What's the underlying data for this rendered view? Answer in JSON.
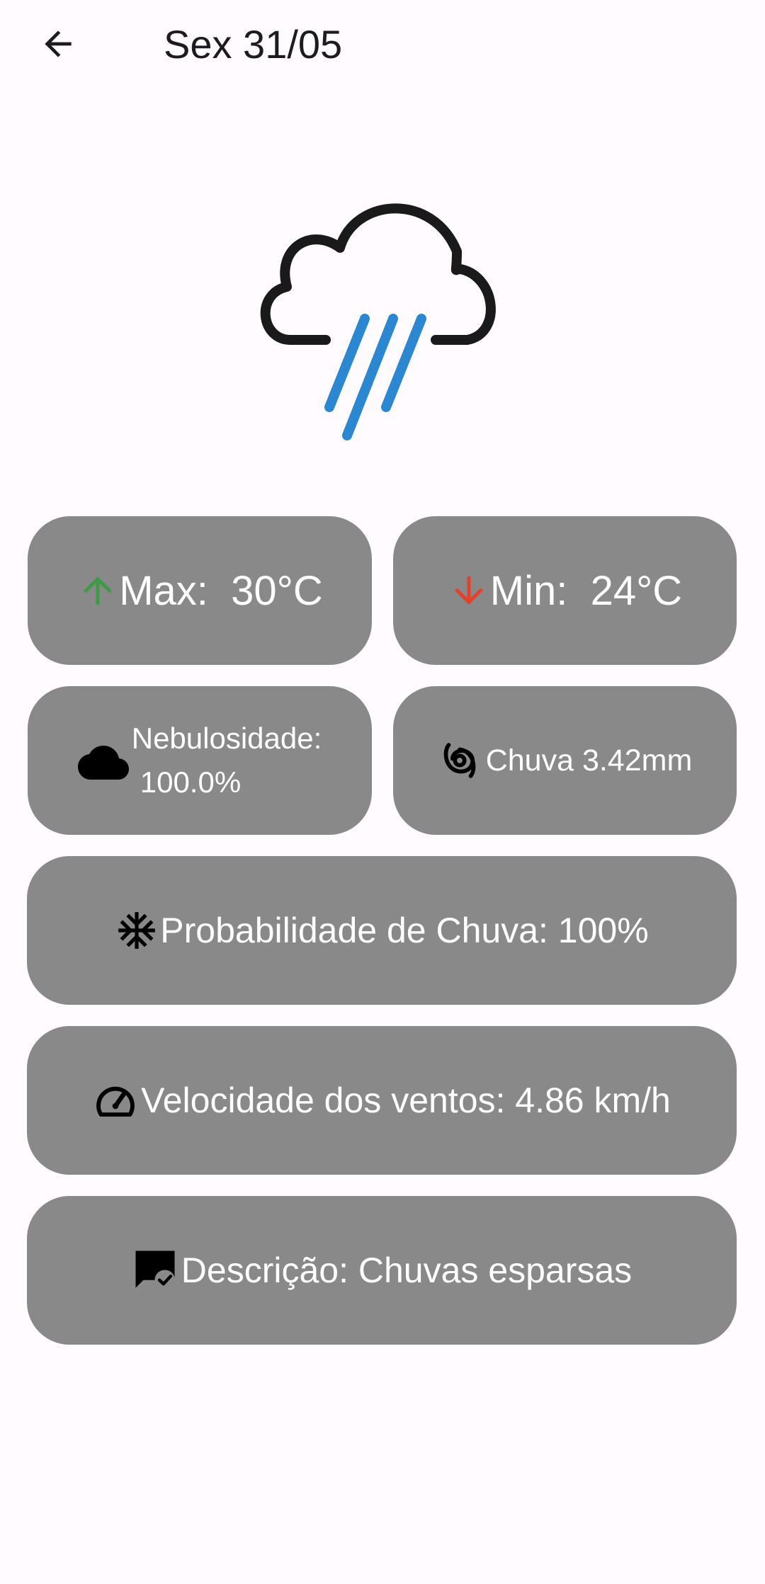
{
  "appbar": {
    "title": "Sex 31/05",
    "back_icon": "arrow-back-icon"
  },
  "weather": {
    "icon": "cloud-rain-icon",
    "colors": {
      "cloud": "#1a1a1a",
      "rain": "#2b88d0"
    }
  },
  "cards": {
    "max": {
      "icon": "arrow-up-icon",
      "color": "#3f9a48",
      "label": "Max:  30°C"
    },
    "min": {
      "icon": "arrow-down-icon",
      "color": "#e2412d",
      "label": "Min:  24°C"
    },
    "cloudiness": {
      "icon": "cloud-icon",
      "line1": "Nebulosidade:",
      "line2": "100.0%"
    },
    "rain": {
      "icon": "cyclone-icon",
      "label": "Chuva 3.42mm"
    },
    "rain_probability": {
      "icon": "snowflake-icon",
      "label": "Probabilidade de Chuva: 100%"
    },
    "wind": {
      "icon": "speedometer-icon",
      "label": "Velocidade dos ventos: 4.86 km/h"
    },
    "description": {
      "icon": "comment-check-icon",
      "label": "Descrição: Chuvas esparsas"
    }
  },
  "theme": {
    "card_bg": "#8a8989",
    "page_bg": "#fffbfe",
    "text": "#ffffff"
  }
}
